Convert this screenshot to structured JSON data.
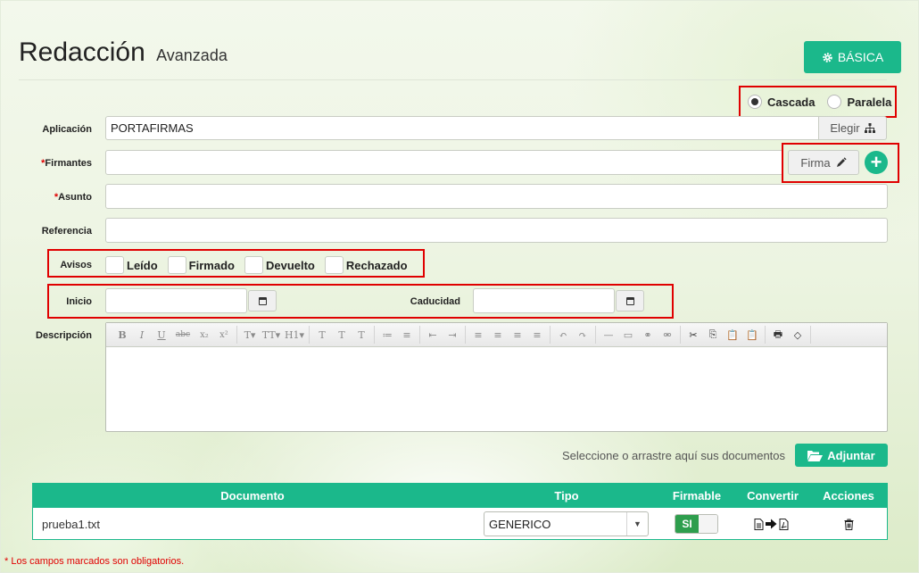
{
  "header": {
    "title": "Redacción",
    "subtitle": "Avanzada",
    "basic_button": "BÁSICA"
  },
  "mode": {
    "options": [
      {
        "label": "Cascada",
        "selected": true
      },
      {
        "label": "Paralela",
        "selected": false
      }
    ]
  },
  "form": {
    "aplicacion_label": "Aplicación",
    "aplicacion_value": "PORTAFIRMAS",
    "elegir_button": "Elegir",
    "firmantes_label": "Firmantes",
    "firmantes_value": "",
    "firma_button": "Firma",
    "asunto_label": "Asunto",
    "asunto_value": "",
    "referencia_label": "Referencia",
    "referencia_value": "",
    "required_mark": "*",
    "avisos_label": "Avisos",
    "avisos": [
      {
        "label": "Leído",
        "checked": false
      },
      {
        "label": "Firmado",
        "checked": false
      },
      {
        "label": "Devuelto",
        "checked": false
      },
      {
        "label": "Rechazado",
        "checked": false
      }
    ],
    "inicio_label": "Inicio",
    "inicio_value": "",
    "caducidad_label": "Caducidad",
    "caducidad_value": "",
    "descripcion_label": "Descripción"
  },
  "editor_toolbar": [
    [
      "B",
      "I",
      "U",
      "abc",
      "x₂",
      "x²"
    ],
    [
      "T▾",
      "TT▾",
      "H1▾"
    ],
    [
      "T",
      "T",
      "T"
    ],
    [
      "≔",
      "≡"
    ],
    [
      "⇤",
      "⇥"
    ],
    [
      "≡",
      "≡",
      "≡",
      "≡"
    ],
    [
      "↶",
      "↷"
    ],
    [
      "—",
      "▭",
      "⚭",
      "⚮"
    ],
    [
      "✂",
      "⎘",
      "📋",
      "📋"
    ],
    [
      "🖶",
      "◇"
    ]
  ],
  "upload": {
    "hint": "Seleccione o arrastre aquí sus documentos",
    "button": "Adjuntar"
  },
  "table": {
    "headers": [
      "Documento",
      "Tipo",
      "Firmable",
      "Convertir",
      "Acciones"
    ],
    "rows": [
      {
        "documento": "prueba1.txt",
        "tipo": "GENERICO",
        "firmable": "SI"
      }
    ]
  },
  "footnote": {
    "mark": "*",
    "text": " Los campos marcados son obligatorios."
  }
}
